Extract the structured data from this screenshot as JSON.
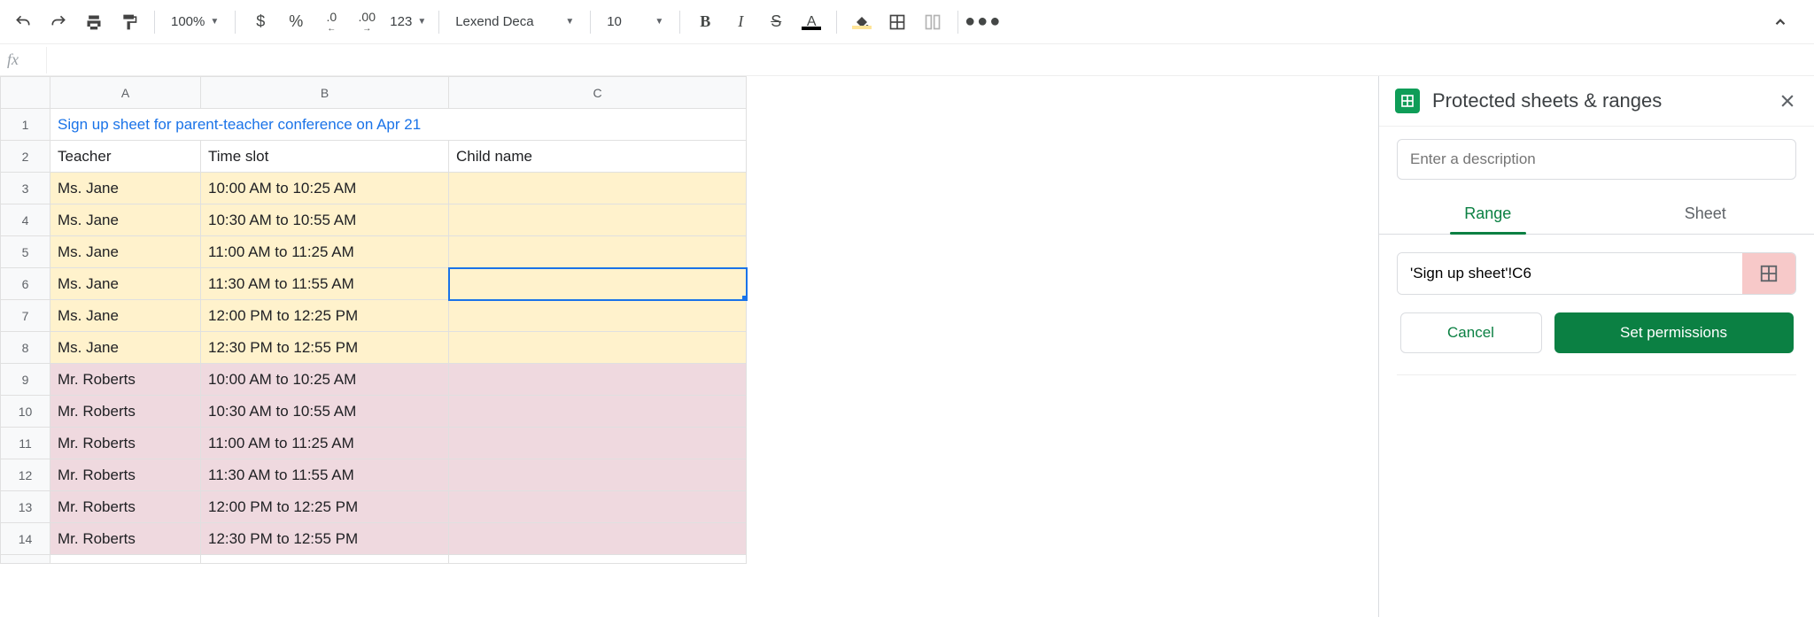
{
  "toolbar": {
    "zoom": "100%",
    "font": "Lexend Deca",
    "font_size": "10",
    "currency_icon": "$",
    "percent_icon": "%",
    "dec_decrease": ".0",
    "dec_increase": ".00",
    "num_format": "123"
  },
  "formula_bar": {
    "fx_label": "fx",
    "value": ""
  },
  "columns": [
    "A",
    "B",
    "C"
  ],
  "rows": [
    {
      "n": 1,
      "merged_title": "Sign up sheet for parent-teacher conference on Apr 21"
    },
    {
      "n": 2,
      "a": "Teacher",
      "b": "Time slot",
      "c": "Child name",
      "class": "hdr-row shadow-under"
    },
    {
      "n": 3,
      "a": "Ms. Jane",
      "b": "10:00 AM to 10:25 AM",
      "c": "",
      "class": "bg-yellow"
    },
    {
      "n": 4,
      "a": "Ms. Jane",
      "b": "10:30 AM to 10:55 AM",
      "c": "",
      "class": "bg-yellow"
    },
    {
      "n": 5,
      "a": "Ms. Jane",
      "b": "11:00 AM to 11:25 AM",
      "c": "",
      "class": "bg-yellow"
    },
    {
      "n": 6,
      "a": "Ms. Jane",
      "b": "11:30 AM to 11:55 AM",
      "c": "",
      "class": "bg-yellow",
      "selected": true
    },
    {
      "n": 7,
      "a": "Ms. Jane",
      "b": "12:00 PM to 12:25 PM",
      "c": "",
      "class": "bg-yellow"
    },
    {
      "n": 8,
      "a": "Ms. Jane",
      "b": "12:30 PM to 12:55 PM",
      "c": "",
      "class": "bg-yellow"
    },
    {
      "n": 9,
      "a": "Mr. Roberts",
      "b": "10:00 AM to 10:25 AM",
      "c": "",
      "class": "bg-pink"
    },
    {
      "n": 10,
      "a": "Mr. Roberts",
      "b": "10:30 AM to 10:55 AM",
      "c": "",
      "class": "bg-pink"
    },
    {
      "n": 11,
      "a": "Mr. Roberts",
      "b": "11:00 AM to 11:25 AM",
      "c": "",
      "class": "bg-pink"
    },
    {
      "n": 12,
      "a": "Mr. Roberts",
      "b": "11:30 AM to 11:55 AM",
      "c": "",
      "class": "bg-pink"
    },
    {
      "n": 13,
      "a": "Mr. Roberts",
      "b": "12:00 PM to 12:25 PM",
      "c": "",
      "class": "bg-pink"
    },
    {
      "n": 14,
      "a": "Mr. Roberts",
      "b": "12:30 PM to 12:55 PM",
      "c": "",
      "class": "bg-pink"
    }
  ],
  "sidebar": {
    "title": "Protected sheets & ranges",
    "desc_placeholder": "Enter a description",
    "tabs": {
      "range": "Range",
      "sheet": "Sheet"
    },
    "range_value": "'Sign up sheet'!C6",
    "cancel": "Cancel",
    "set_perms": "Set permissions"
  }
}
